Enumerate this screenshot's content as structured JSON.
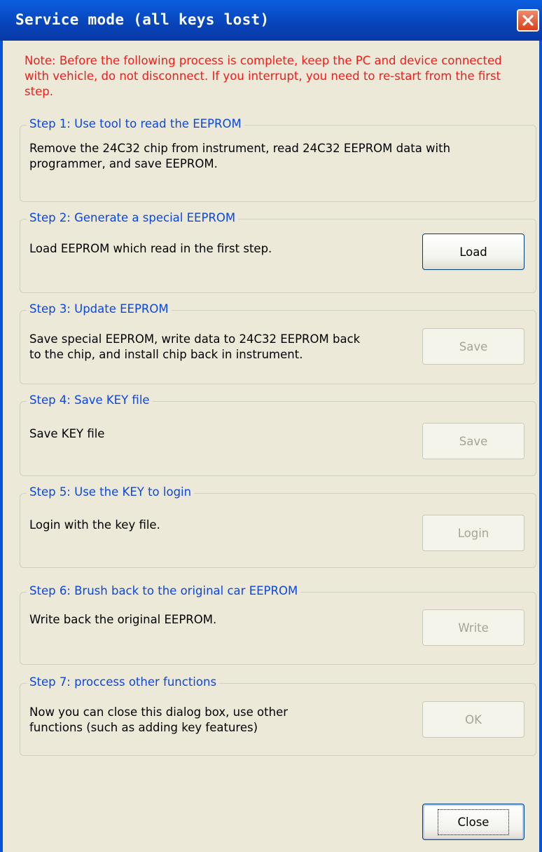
{
  "window": {
    "title": "Service mode (all keys lost)"
  },
  "note": "Note: Before the following process is complete, keep the PC and device connected with vehicle, do not disconnect. If you interrupt, you need to re-start from the first step.",
  "steps": [
    {
      "title": "Step 1: Use tool to read the EEPROM",
      "lines": [
        "Remove the 24C32 chip from instrument, read 24C32 EEPROM data with",
        "programmer, and save EEPROM."
      ]
    },
    {
      "title": "Step 2: Generate a special EEPROM",
      "lines": [
        "Load EEPROM which read in the first step."
      ],
      "button": "Load",
      "enabled": true
    },
    {
      "title": "Step 3: Update EEPROM",
      "lines": [
        "Save special EEPROM, write data to 24C32 EEPROM back",
        "to the chip, and install chip back in instrument."
      ],
      "button": "Save",
      "enabled": false
    },
    {
      "title": "Step 4: Save KEY file",
      "lines": [
        "Save KEY file"
      ],
      "button": "Save",
      "enabled": false
    },
    {
      "title": "Step 5: Use the KEY to login",
      "lines": [
        "Login with the key file."
      ],
      "button": "Login",
      "enabled": false
    },
    {
      "title": "Step 6: Brush back to the original car EEPROM",
      "lines": [
        "Write back the original EEPROM."
      ],
      "button": "Write",
      "enabled": false
    },
    {
      "title": "Step 7: proccess other functions",
      "lines": [
        "Now you can close this dialog box, use other",
        "functions (such as adding key features)"
      ],
      "button": "OK",
      "enabled": false
    }
  ],
  "footer": {
    "close_label": "Close"
  },
  "colors": {
    "note": "#f41b1b",
    "group_title": "#0b47e0",
    "title_bar": "#0843b8"
  }
}
